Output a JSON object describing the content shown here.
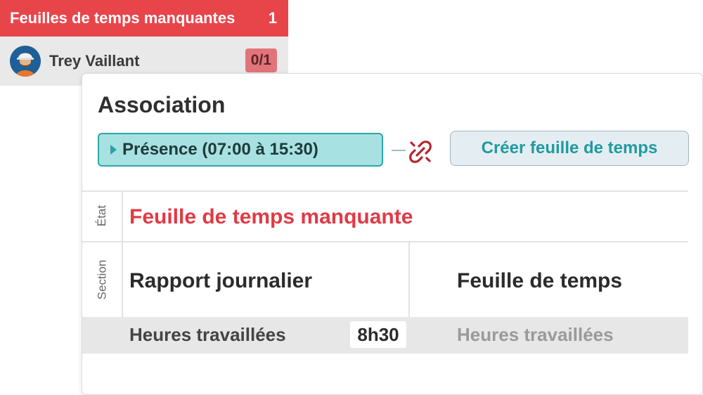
{
  "missing": {
    "title": "Feuilles de temps manquantes",
    "count": "1",
    "header_color": "#e8454b",
    "employee": {
      "name": "Trey Vaillant",
      "badge": "0/1",
      "avatar_icon": "worker-avatar"
    }
  },
  "association": {
    "title": "Association",
    "presence_label": "Présence (07:00 à 15:30)",
    "presence_icon": "caret-right-icon",
    "unlink_icon": "broken-link-icon",
    "create_button_label": "Créer feuille de temps",
    "accent_color": "#2ba7a9",
    "status": {
      "side_label": "État",
      "value": "Feuille de temps manquante",
      "color": "#e03a45"
    },
    "section": {
      "side_label": "Section",
      "left_title": "Rapport journalier",
      "right_title": "Feuille de temps"
    },
    "hours": {
      "left_label": "Heures travaillées",
      "left_value": "8h30",
      "right_label": "Heures travaillées"
    }
  }
}
